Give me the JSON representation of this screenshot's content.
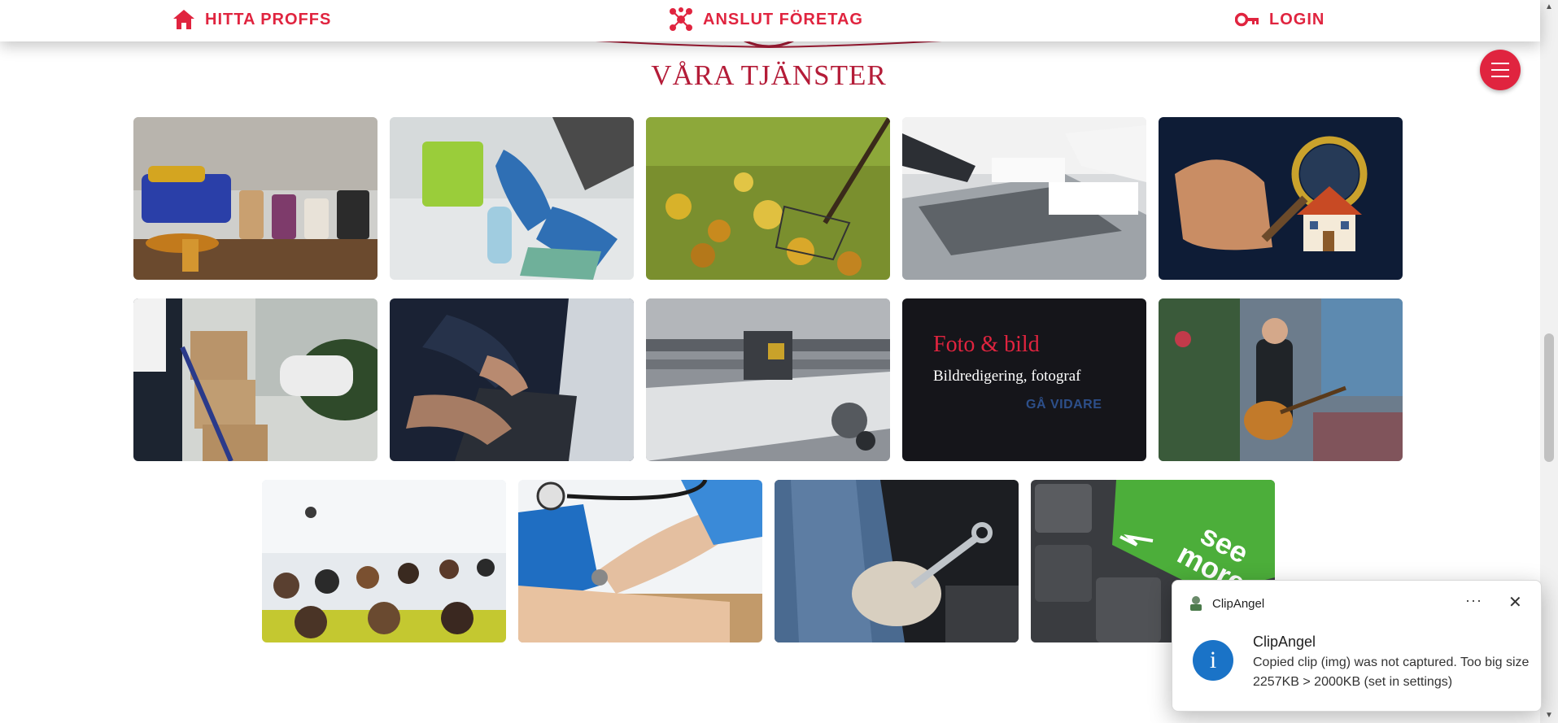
{
  "nav": {
    "find_pros": "HITTA PROFFS",
    "connect_company": "ANSLUT FÖRETAG",
    "login": "LOGIN"
  },
  "section_title": "VÅRA TJÄNSTER",
  "services": [
    {
      "name": "crafts-tile"
    },
    {
      "name": "cleaning-tile"
    },
    {
      "name": "garden-tile"
    },
    {
      "name": "accounting-tile"
    },
    {
      "name": "real-estate-tile"
    },
    {
      "name": "moving-tile"
    },
    {
      "name": "it-tile"
    },
    {
      "name": "printing-tile"
    },
    {
      "name": "photo-tile",
      "title": "Foto & bild",
      "subtitle": "Bildredigering, fotograf",
      "link": "GÅ VIDARE"
    },
    {
      "name": "music-tile"
    },
    {
      "name": "education-tile"
    },
    {
      "name": "healthcare-tile"
    },
    {
      "name": "repair-tile"
    },
    {
      "name": "see-more-tile",
      "key_text": "see more"
    }
  ],
  "toast": {
    "app_name": "ClipAngel",
    "more": "···",
    "close": "✕",
    "info": "i",
    "title": "ClipAngel",
    "body": "Copied clip (img) was not captured. Too big size 2257KB > 2000KB (set in settings)"
  },
  "colors": {
    "accent": "#e0243f",
    "title": "#b41c38",
    "toast_info": "#1a73c7"
  }
}
